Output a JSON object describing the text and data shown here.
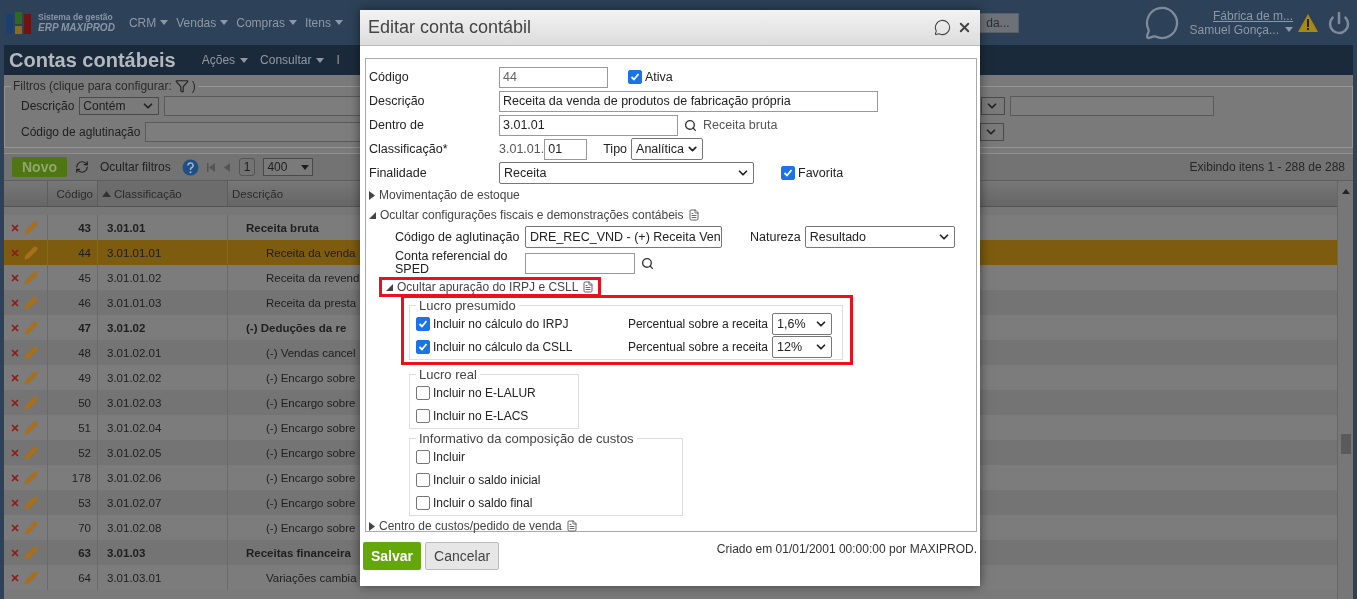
{
  "top_nav": {
    "logo": {
      "line1": "Sistema de gestão",
      "line2": "ERP MAXIPROD"
    },
    "menu": [
      {
        "label": "CRM"
      },
      {
        "label": "Vendas"
      },
      {
        "label": "Compras"
      },
      {
        "label": "Itens"
      }
    ],
    "hidden_button": "da...",
    "company": "Fábrica de m...",
    "user": "Samuel Gonça..."
  },
  "page": {
    "title": "Contas contábeis",
    "menu": [
      {
        "label": "Ações",
        "caret": true
      },
      {
        "label": "Consultar",
        "caret": true
      },
      {
        "label": "I",
        "caret": false
      }
    ]
  },
  "filters": {
    "legend": "Filtros (clique para configurar:",
    "legend_end": ")",
    "description": {
      "label": "Descrição",
      "operator": "Contém"
    },
    "aglutinacao": {
      "label": "Código de aglutinação"
    }
  },
  "toolbar": {
    "new": "Novo",
    "hide_filters": "Ocultar filtros",
    "page": "1",
    "page_size": "400",
    "summary": "Exibindo itens 1 - 288 de 288"
  },
  "table": {
    "columns": [
      {
        "label": "Código",
        "sorted": false
      },
      {
        "label": "Classificação",
        "sorted": true
      },
      {
        "label": "Descrição",
        "sorted": false
      }
    ],
    "rows": [
      {
        "code": "43",
        "classification": "3.01.01",
        "description": "Receita bruta",
        "selected": false,
        "children": [
          {
            "code": "44",
            "classification": "3.01.01.01",
            "description": "Receita da venda",
            "selected": true
          },
          {
            "code": "45",
            "classification": "3.01.01.02",
            "description": "Receita da revend",
            "selected": false
          },
          {
            "code": "46",
            "classification": "3.01.01.03",
            "description": "Receita da presta",
            "selected": false
          }
        ]
      },
      {
        "code": "47",
        "classification": "3.01.02",
        "description": "(-) Deduções da re",
        "selected": false,
        "children": [
          {
            "code": "48",
            "classification": "3.01.02.01",
            "description": "(-) Vendas cancel",
            "selected": false
          },
          {
            "code": "49",
            "classification": "3.01.02.02",
            "description": "(-) Encargo sobre",
            "selected": false
          },
          {
            "code": "50",
            "classification": "3.01.02.03",
            "description": "(-) Encargo sobre",
            "selected": false
          },
          {
            "code": "51",
            "classification": "3.01.02.04",
            "description": "(-) Encargo sobre",
            "selected": false
          },
          {
            "code": "52",
            "classification": "3.01.02.05",
            "description": "(-) Encargo sobre",
            "selected": false
          },
          {
            "code": "178",
            "classification": "3.01.02.06",
            "description": "(-) Encargo sobre",
            "selected": false
          },
          {
            "code": "53",
            "classification": "3.01.02.07",
            "description": "(-) Encargo sobre",
            "selected": false
          },
          {
            "code": "70",
            "classification": "3.01.02.08",
            "description": "(-) Encargo sobre",
            "selected": false
          }
        ]
      },
      {
        "code": "63",
        "classification": "3.01.03",
        "description": "Receitas financeira",
        "selected": false,
        "children": [
          {
            "code": "64",
            "classification": "3.01.03.01",
            "description": "Variações cambia",
            "selected": false
          }
        ]
      }
    ]
  },
  "dialog": {
    "title": "Editar conta contábil",
    "code": {
      "label": "Código",
      "value": "44"
    },
    "active": {
      "label": "Ativa",
      "checked": true
    },
    "description": {
      "label": "Descrição",
      "value": "Receita da venda de produtos de fabricação própria"
    },
    "parent": {
      "label": "Dentro de",
      "value": "3.01.01",
      "name": "Receita bruta"
    },
    "classification": {
      "label": "Classificação*",
      "prefix": "3.01.01.",
      "value": "01"
    },
    "type": {
      "label": "Tipo",
      "value": "Analítica"
    },
    "purpose": {
      "label": "Finalidade",
      "value": "Receita"
    },
    "favorite": {
      "label": "Favorita",
      "checked": true
    },
    "stock_section": {
      "title": "Movimentação de estoque",
      "expanded": false
    },
    "fiscal_section": {
      "title": "Ocultar configurações fiscais e demonstrações contábeis",
      "expanded": true,
      "aglutinacao": {
        "label": "Código de aglutinação",
        "value": "DRE_REC_VND - (+) Receita Ven"
      },
      "natureza": {
        "label": "Natureza",
        "value": "Resultado"
      },
      "sped": {
        "label": "Conta referencial do SPED"
      },
      "irpj_section": {
        "title": "Ocultar apuração do IRPJ e CSLL",
        "expanded": true,
        "highlighted": true,
        "groups": [
          {
            "title": "Lucro presumido",
            "highlighted": true,
            "items": [
              {
                "label": "Incluir no cálculo do IRPJ",
                "checked": true,
                "percent_label": "Percentual sobre a receita",
                "percent": "1,6%"
              },
              {
                "label": "Incluir no cálculo da CSLL",
                "checked": true,
                "percent_label": "Percentual sobre a receita",
                "percent": "12%"
              }
            ]
          },
          {
            "title": "Lucro real",
            "highlighted": false,
            "items": [
              {
                "label": "Incluir no E-LALUR",
                "checked": false
              },
              {
                "label": "Incluir no E-LACS",
                "checked": false
              }
            ]
          },
          {
            "title": "Informativo da composição de custos",
            "highlighted": false,
            "items": [
              {
                "label": "Incluir",
                "checked": false
              },
              {
                "label": "Incluir o saldo inicial",
                "checked": false
              },
              {
                "label": "Incluir o saldo final",
                "checked": false
              }
            ]
          }
        ]
      }
    },
    "cost_section": {
      "title": "Centro de custos/pedido de venda",
      "expanded": false
    },
    "save": "Salvar",
    "cancel": "Cancelar",
    "created": "Criado em 01/01/2001 00:00:00 por MAXIPROD."
  }
}
